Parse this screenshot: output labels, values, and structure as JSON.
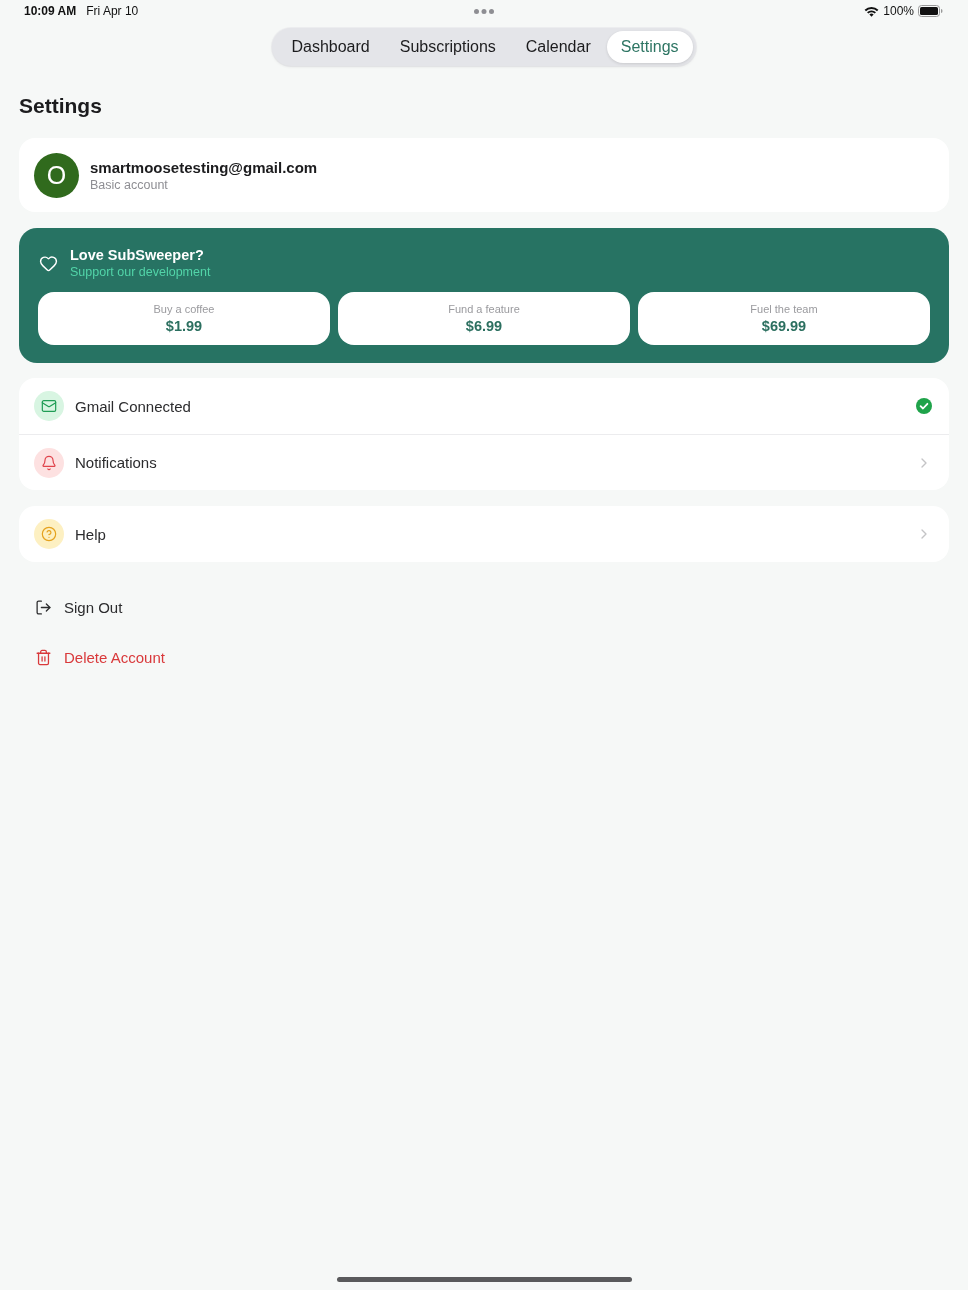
{
  "status_bar": {
    "time": "10:09 AM",
    "date": "Fri Apr 10",
    "battery": "100%"
  },
  "tabs": [
    {
      "label": "Dashboard",
      "selected": false
    },
    {
      "label": "Subscriptions",
      "selected": false
    },
    {
      "label": "Calendar",
      "selected": false
    },
    {
      "label": "Settings",
      "selected": true
    }
  ],
  "page_title": "Settings",
  "account": {
    "avatar_initial": "O",
    "email": "smartmoosetesting@gmail.com",
    "plan": "Basic account"
  },
  "support": {
    "title": "Love SubSweeper?",
    "subtitle": "Support our development",
    "options": [
      {
        "label": "Buy a coffee",
        "price": "$1.99"
      },
      {
        "label": "Fund a feature",
        "price": "$6.99"
      },
      {
        "label": "Fuel the team",
        "price": "$69.99"
      }
    ]
  },
  "settings_groups": [
    {
      "items": [
        {
          "label": "Gmail Connected",
          "kind": "status"
        },
        {
          "label": "Notifications",
          "kind": "link"
        }
      ]
    },
    {
      "items": [
        {
          "label": "Help",
          "kind": "link"
        }
      ]
    }
  ],
  "actions": [
    {
      "label": "Sign Out",
      "kind": "default"
    },
    {
      "label": "Delete Account",
      "kind": "destructive"
    }
  ]
}
